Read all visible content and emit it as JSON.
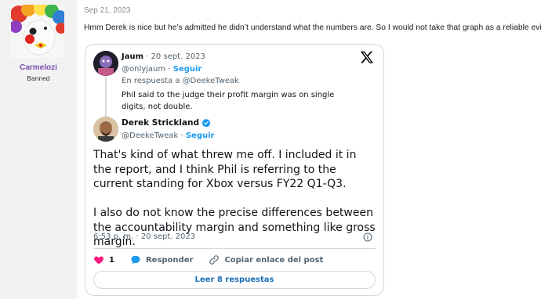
{
  "user": {
    "name": "Carmelozi",
    "title": "Banned"
  },
  "post": {
    "date": "Sep 21, 2023",
    "body": "Hmm Derek is nice but he’s admitted he didn’t understand what the numbers are. So I would not take that graph as a reliable evidence."
  },
  "tweet": {
    "quoted": {
      "name": "Jaum",
      "date": "· 20 sept. 2023",
      "handle": "@onlyjaum",
      "separator": "·",
      "follow_label": "Seguir",
      "reply_to": "En respuesta a @DeekeTweak",
      "text": "Phil said to the judge their profit margin was on single digits, not double."
    },
    "main": {
      "name": "Derek Strickland",
      "handle": "@DeekeTweak",
      "separator": "·",
      "follow_label": "Seguir",
      "paragraph_1": "That's kind of what threw me off. I included it in the report, and I think Phil is referring to the current standing for Xbox versus FY22 Q1-Q3.",
      "paragraph_2": "I also do not know the precise differences between the accountability margin and something like gross margin.",
      "timestamp": "6:53 p. m. · 20 sept. 2023"
    },
    "actions": {
      "likes": "1",
      "reply_label": "Responder",
      "copy_label": "Copiar enlace del post"
    },
    "read_more_label": "Leer 8 respuestas"
  },
  "colors": {
    "username": "#7a4fb0",
    "accent": "#1d9bf0",
    "like": "#f91880",
    "sidebar": "#f2f2f2"
  },
  "icons": {
    "x_logo": "x-logo-icon",
    "verified": "verified-badge-icon",
    "info": "info-icon",
    "like": "heart-icon",
    "reply": "speech-bubble-icon",
    "copy": "link-icon"
  }
}
